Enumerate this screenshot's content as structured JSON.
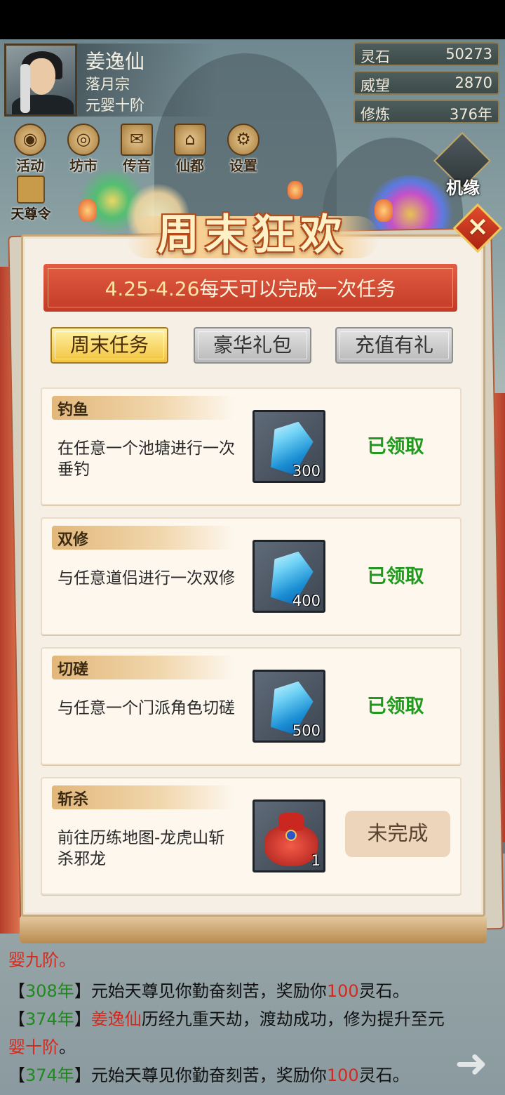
{
  "player": {
    "name": "姜逸仙",
    "sect": "落月宗",
    "rank": "元婴十阶"
  },
  "stats": [
    {
      "label": "灵石",
      "value": "50273"
    },
    {
      "label": "威望",
      "value": "2870"
    },
    {
      "label": "修炼",
      "value": "376年"
    }
  ],
  "top_icons": [
    {
      "label": "活动",
      "icon": "activity-icon"
    },
    {
      "label": "坊市",
      "icon": "market-icon"
    },
    {
      "label": "传音",
      "icon": "mail-icon"
    },
    {
      "label": "仙都",
      "icon": "pagoda-icon"
    },
    {
      "label": "设置",
      "icon": "gear-icon"
    }
  ],
  "side_icons": {
    "jiyuan": "机缘",
    "tianzun": "天尊令"
  },
  "event": {
    "title": "周末狂欢",
    "close": "×",
    "date_range": "4.25-4.26",
    "date_desc": "每天可以完成一次任务"
  },
  "tabs": [
    {
      "label": "周末任务",
      "active": true
    },
    {
      "label": "豪华礼包",
      "active": false
    },
    {
      "label": "充值有礼",
      "active": false
    }
  ],
  "tasks": [
    {
      "tag": "钓鱼",
      "desc": "在任意一个池塘进行一次垂钓",
      "reward_icon": "spirit-stone-icon",
      "qty": "300",
      "status": "已领取"
    },
    {
      "tag": "双修",
      "desc": "与任意道侣进行一次双修",
      "reward_icon": "spirit-stone-icon",
      "qty": "400",
      "status": "已领取"
    },
    {
      "tag": "切磋",
      "desc": "与任意一个门派角色切磋",
      "reward_icon": "spirit-stone-icon",
      "qty": "500",
      "status": "已领取"
    },
    {
      "tag": "斩杀",
      "desc": "前往历练地图-龙虎山斩杀邪龙",
      "reward_icon": "red-bag-icon",
      "qty": "1",
      "status": "未完成"
    }
  ],
  "log": {
    "l0_tail": "婴九阶。",
    "l1": {
      "yr": "308年",
      "pre": "元始天尊见你勤奋刻苦，奖励你",
      "num": "100",
      "post": "灵石。"
    },
    "l2": {
      "yr": "374年",
      "name": "姜逸仙",
      "mid": "历经九重天劫，渡劫成功，修为提升至元",
      "tail": "婴十阶",
      "end": "。"
    },
    "l3": {
      "yr": "374年",
      "pre": "元始天尊见你勤奋刻苦，奖励你",
      "num": "100",
      "post": "灵石。"
    },
    "lb": "【",
    "rb": "】"
  },
  "colors": {
    "accent_red": "#c23b26",
    "claimed_green": "#1f9a1d",
    "gold": "#f2c33c"
  }
}
